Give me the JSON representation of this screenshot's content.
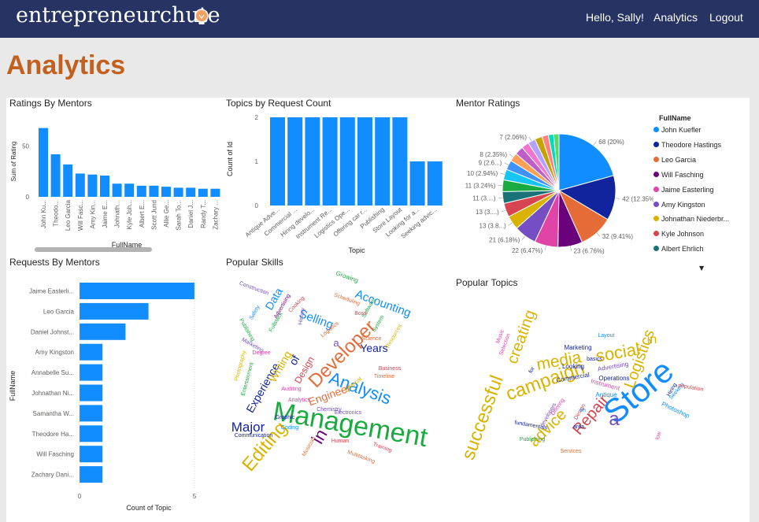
{
  "header": {
    "logo_text": "entrepreneurchute",
    "greeting": "Hello, Sally!",
    "nav_analytics": "Analytics",
    "nav_logout": "Logout"
  },
  "page_title": "Analytics",
  "colors": {
    "header_bg": "#263363",
    "title": "#c1601f",
    "bar": "#118dff"
  },
  "panels": {
    "ratings_title": "Ratings By Mentors",
    "topics_title": "Topics by Request Count",
    "mentor_ratings_title": "Mentor Ratings",
    "requests_title": "Requests By Mentors",
    "skills_title": "Popular Skills",
    "popular_topics_title": "Popular Topics"
  },
  "mentor_legend": {
    "title": "FullName",
    "items": [
      {
        "label": "John Kuefler",
        "color": "#118dff"
      },
      {
        "label": "Theodore Hastings",
        "color": "#12239e"
      },
      {
        "label": "Leo Garcia",
        "color": "#e66c37"
      },
      {
        "label": "Will Fasching",
        "color": "#6b007b"
      },
      {
        "label": "Jaime Easterling",
        "color": "#e044a7"
      },
      {
        "label": "Amy Kingston",
        "color": "#744ec2"
      },
      {
        "label": "Johnathan Niederbr...",
        "color": "#d9b300"
      },
      {
        "label": "Kyle Johnson",
        "color": "#d64550"
      },
      {
        "label": "Albert Ehrlich",
        "color": "#197278"
      }
    ]
  },
  "chart_data": [
    {
      "type": "bar",
      "title": "Ratings By Mentors",
      "xlabel": "FullName",
      "ylabel": "Sum of Rating",
      "ylim": [
        0,
        70
      ],
      "yticks": [
        0,
        50
      ],
      "categories": [
        "John Ku...",
        "Theodo...",
        "Leo Garcia",
        "Will Fasc...",
        "Amy Kin...",
        "Jaime E...",
        "Johnath...",
        "Kyle Joh...",
        "Albert E...",
        "Scott Jund",
        "Allie Ge...",
        "Sarah To...",
        "Daniel J...",
        "Randy T...",
        "Zachary ..."
      ],
      "values": [
        68,
        42,
        32,
        23,
        22,
        21,
        13,
        13,
        11,
        11,
        10,
        9,
        9,
        8,
        8
      ]
    },
    {
      "type": "bar",
      "title": "Topics by Request Count",
      "xlabel": "Topic",
      "ylabel": "Count of Id",
      "ylim": [
        0,
        2
      ],
      "yticks": [
        0,
        1,
        2
      ],
      "categories": [
        "Antique Adve...",
        "Commercial ...",
        "Hiring develo...",
        "Instrument Re...",
        "Logistics Ope...",
        "Offering car r...",
        "Publishing",
        "Store Layout",
        "Looking for a...",
        "Seeking advic..."
      ],
      "values": [
        2,
        2,
        2,
        2,
        2,
        2,
        2,
        2,
        1,
        1
      ]
    },
    {
      "type": "pie",
      "title": "Mentor Ratings",
      "legend_title": "FullName",
      "slices": [
        {
          "label": "68 (20%)",
          "value": 68,
          "color": "#118dff"
        },
        {
          "label": "42 (12.35%)",
          "value": 42,
          "color": "#12239e"
        },
        {
          "label": "32 (9.41%)",
          "value": 32,
          "color": "#e66c37"
        },
        {
          "label": "23 (6.76%)",
          "value": 23,
          "color": "#6b007b"
        },
        {
          "label": "22 (6.47%)",
          "value": 22,
          "color": "#e044a7"
        },
        {
          "label": "21 (6.18%)",
          "value": 21,
          "color": "#744ec2"
        },
        {
          "label": "13 (3.8...)",
          "value": 13,
          "color": "#d9b300"
        },
        {
          "label": "13 (3....)",
          "value": 13,
          "color": "#d64550"
        },
        {
          "label": "11 (3....)",
          "value": 11,
          "color": "#197278"
        },
        {
          "label": "11 (3.24%)",
          "value": 11,
          "color": "#1aab40"
        },
        {
          "label": "10 (2.94%)",
          "value": 10,
          "color": "#15c6f4"
        },
        {
          "label": "9 (2.6...)",
          "value": 9,
          "color": "#4092ff"
        },
        {
          "label": "8 (2.35%)",
          "value": 8,
          "color": "#ffa058"
        },
        {
          "label": "8",
          "value": 8,
          "color": "#be5dc9"
        },
        {
          "label": "7",
          "value": 7,
          "color": "#f472d0"
        },
        {
          "label": "7 (2.06%)",
          "value": 7,
          "color": "#b5a1ff"
        },
        {
          "label": "7",
          "value": 7,
          "color": "#c4a200"
        },
        {
          "label": "6",
          "value": 6,
          "color": "#ff8080"
        },
        {
          "label": "5",
          "value": 5,
          "color": "#00dbbc"
        },
        {
          "label": "5",
          "value": 5,
          "color": "#5bd667"
        }
      ]
    },
    {
      "type": "bar",
      "orientation": "horizontal",
      "title": "Requests By Mentors",
      "xlabel": "Count of Topic",
      "ylabel": "FullName",
      "xlim": [
        0,
        5
      ],
      "xticks": [
        0,
        5
      ],
      "categories": [
        "Jaime Easterli...",
        "Leo Garcia",
        "Daniel Johnst...",
        "Amy Kingston",
        "Annabelle Su...",
        "Johnathan Ni...",
        "Samantha W...",
        "Theodore Ha...",
        "Will Fasching",
        "Zachary Dani..."
      ],
      "values": [
        5,
        3,
        2,
        1,
        1,
        1,
        1,
        1,
        1,
        1
      ]
    }
  ],
  "skills_words": [
    {
      "text": "Management",
      "color": "#1aab40"
    },
    {
      "text": "Analysis",
      "color": "#118dff"
    },
    {
      "text": "Developer",
      "color": "#e66c37"
    },
    {
      "text": "Editing",
      "color": "#d9b300"
    },
    {
      "text": "Major",
      "color": "#12239e"
    },
    {
      "text": "in",
      "color": "#6b007b"
    },
    {
      "text": "Engineer",
      "color": "#e66c37"
    },
    {
      "text": "Experience",
      "color": "#12239e"
    },
    {
      "text": "Writing",
      "color": "#d9b300"
    },
    {
      "text": "Design",
      "color": "#d64550"
    },
    {
      "text": "Accounting",
      "color": "#118dff"
    },
    {
      "text": "Selling",
      "color": "#118dff"
    },
    {
      "text": "Data",
      "color": "#118dff"
    },
    {
      "text": "Years",
      "color": "#12239e"
    },
    {
      "text": "of",
      "color": "#12239e"
    },
    {
      "text": "a",
      "color": "#744ec2"
    },
    {
      "text": "Growing",
      "color": "#1aab40"
    },
    {
      "text": "Scheduling",
      "color": "#e66c37"
    },
    {
      "text": "Construction",
      "color": "#744ec2"
    },
    {
      "text": "Fullstack",
      "color": "#1aab40"
    },
    {
      "text": "Photography",
      "color": "#d9b300"
    },
    {
      "text": "Entertainment",
      "color": "#1aab40"
    },
    {
      "text": "Communication",
      "color": "#12239e"
    },
    {
      "text": "Multitasking",
      "color": "#e66c37"
    },
    {
      "text": "Training",
      "color": "#d64550"
    },
    {
      "text": "Electronics",
      "color": "#744ec2"
    },
    {
      "text": "Chemistry",
      "color": "#744ec2"
    },
    {
      "text": "Business",
      "color": "#d64550"
    },
    {
      "text": "Timeline",
      "color": "#e66c37"
    },
    {
      "text": "Editorial",
      "color": "#d9b300"
    },
    {
      "text": "Publishing",
      "color": "#1aab40"
    },
    {
      "text": "Marketing",
      "color": "#744ec2"
    },
    {
      "text": "Graphic",
      "color": "#12239e"
    },
    {
      "text": "Coding",
      "color": "#118dff"
    },
    {
      "text": "Musician",
      "color": "#e66c37"
    },
    {
      "text": "Human",
      "color": "#d64550"
    },
    {
      "text": "Auditing",
      "color": "#e044a7"
    },
    {
      "text": "Analytics",
      "color": "#e044a7"
    },
    {
      "text": "Resources",
      "color": "#d9b300"
    },
    {
      "text": "Software",
      "color": "#1aab40"
    },
    {
      "text": "Science",
      "color": "#e66c37"
    },
    {
      "text": "History",
      "color": "#744ec2"
    },
    {
      "text": "Cooking",
      "color": "#d64550"
    },
    {
      "text": "Safety",
      "color": "#118dff"
    },
    {
      "text": "Degree",
      "color": "#e044a7"
    },
    {
      "text": "Advertising",
      "color": "#6b007b"
    },
    {
      "text": "System",
      "color": "#1aab40"
    },
    {
      "text": "Boss",
      "color": "#d64550"
    },
    {
      "text": "Logistics",
      "color": "#e66c37"
    }
  ],
  "topics_words": [
    {
      "text": "Store",
      "color": "#118dff"
    },
    {
      "text": "campaign",
      "color": "#d9b300"
    },
    {
      "text": "successful",
      "color": "#d9b300"
    },
    {
      "text": "social",
      "color": "#d9b300"
    },
    {
      "text": "media",
      "color": "#d9b300"
    },
    {
      "text": "Repair",
      "color": "#d64550"
    },
    {
      "text": "Logistics",
      "color": "#d9b300"
    },
    {
      "text": "advice",
      "color": "#d9b300"
    },
    {
      "text": "creating",
      "color": "#d9b300"
    },
    {
      "text": "a",
      "color": "#744ec2"
    },
    {
      "text": "in",
      "color": "#d9b300"
    },
    {
      "text": "Marketing",
      "color": "#12239e"
    },
    {
      "text": "Commercial",
      "color": "#12239e"
    },
    {
      "text": "Looking",
      "color": "#12239e"
    },
    {
      "text": "Advertising",
      "color": "#744ec2"
    },
    {
      "text": "Operations",
      "color": "#12239e"
    },
    {
      "text": "Instrument",
      "color": "#e044a7"
    },
    {
      "text": "Antique",
      "color": "#118dff"
    },
    {
      "text": "Hiring",
      "color": "#12239e"
    },
    {
      "text": "Seeking",
      "color": "#118dff"
    },
    {
      "text": "Photoshop",
      "color": "#118dff"
    },
    {
      "text": "population",
      "color": "#d64550"
    },
    {
      "text": "Layout",
      "color": "#118dff"
    },
    {
      "text": "Music",
      "color": "#e044a7"
    },
    {
      "text": "Selection",
      "color": "#e044a7"
    },
    {
      "text": "Publishing",
      "color": "#1aab40"
    },
    {
      "text": "fundamentals",
      "color": "#12239e"
    },
    {
      "text": "developers",
      "color": "#744ec2"
    },
    {
      "text": "Offering",
      "color": "#e044a7"
    },
    {
      "text": "Services",
      "color": "#e66c37"
    },
    {
      "text": "area",
      "color": "#12239e"
    },
    {
      "text": "Design",
      "color": "#d64550"
    },
    {
      "text": "basics",
      "color": "#12239e"
    },
    {
      "text": "low",
      "color": "#e044a7"
    },
    {
      "text": "on",
      "color": "#118dff"
    },
    {
      "text": "for",
      "color": "#12239e"
    }
  ]
}
